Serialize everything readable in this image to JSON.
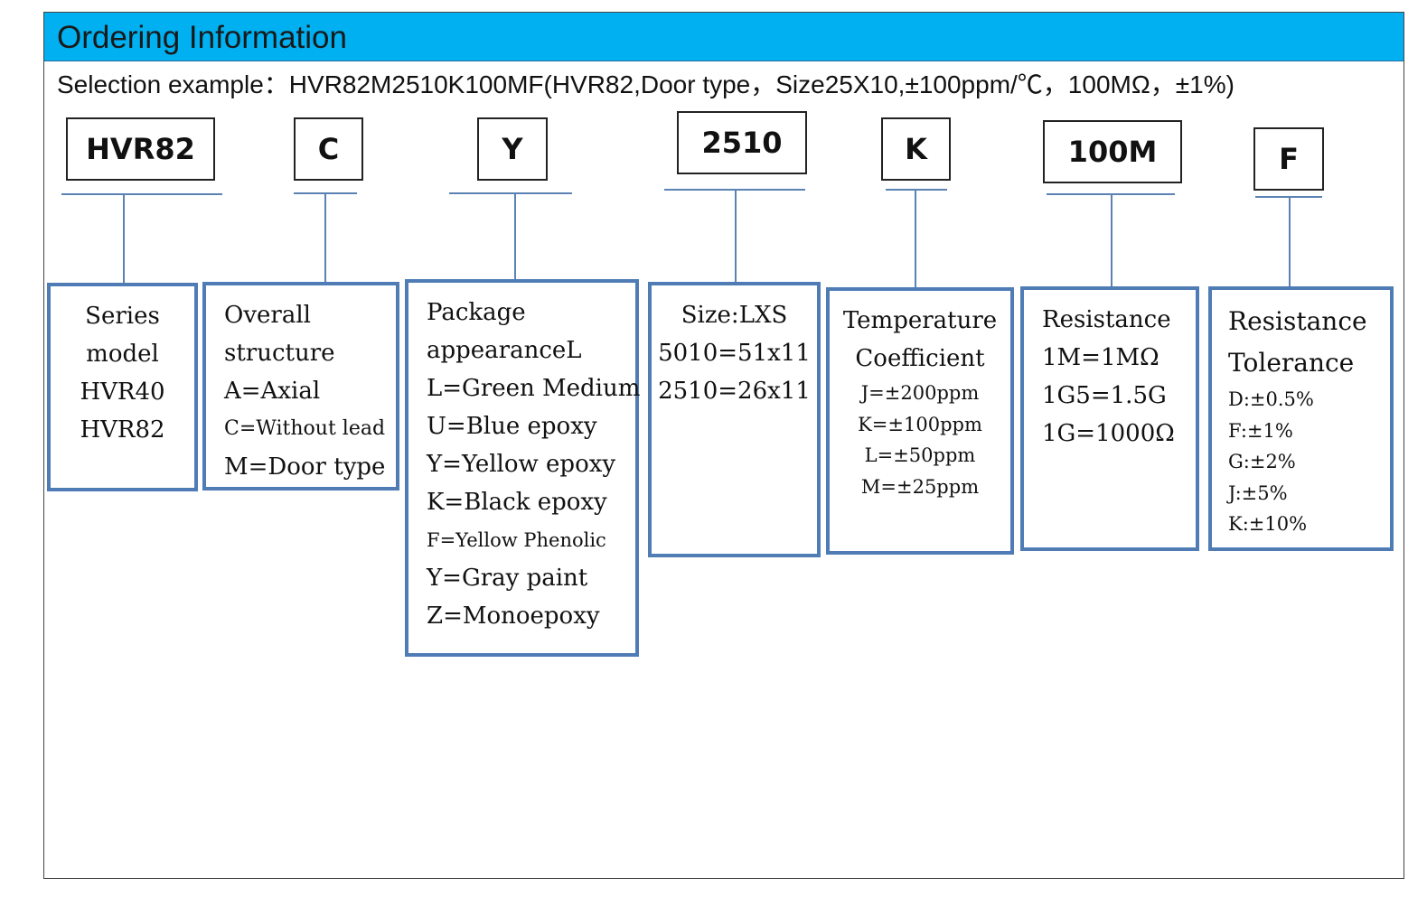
{
  "header": {
    "title": "Ordering Information"
  },
  "example": {
    "text": "Selection example：HVR82M2510K100MF(HVR82,Door type，Size25X10,±100ppm/℃，100MΩ，±1%)"
  },
  "codes": [
    "HVR82",
    "C",
    "Y",
    "2510",
    "K",
    "100M",
    "F"
  ],
  "groups": [
    {
      "lines": [
        "Series",
        "model",
        "HVR40",
        "HVR82"
      ]
    },
    {
      "lines": [
        "Overall",
        "structure",
        "A=Axial",
        "C=Without lead",
        "M=Door type"
      ]
    },
    {
      "lines": [
        "Package",
        "appearanceL",
        "L=Green Medium",
        "U=Blue epoxy",
        "Y=Yellow epoxy",
        "K=Black epoxy",
        "F=Yellow Phenolic",
        "Y=Gray paint",
        "Z=Monoepoxy"
      ]
    },
    {
      "lines": [
        "Size:LXS",
        "5010=51x11",
        "2510=26x11"
      ]
    },
    {
      "lines": [
        "Temperature",
        "Coefficient"
      ],
      "items": [
        "J=±200ppm",
        "K=±100ppm",
        "L=±50ppm",
        "M=±25ppm"
      ]
    },
    {
      "lines": [
        "Resistance",
        "1M=1MΩ",
        "1G5=1.5G",
        "1G=1000Ω"
      ]
    },
    {
      "lines": [
        "Resistance",
        "Tolerance"
      ],
      "items": [
        "D:±0.5%",
        "F:±1%",
        "G:±2%",
        "J:±5%",
        "K:±10%"
      ]
    }
  ],
  "colors": {
    "header": "#00b0f0",
    "box_border": "#4f7cb5",
    "connector": "#5a83b3"
  }
}
